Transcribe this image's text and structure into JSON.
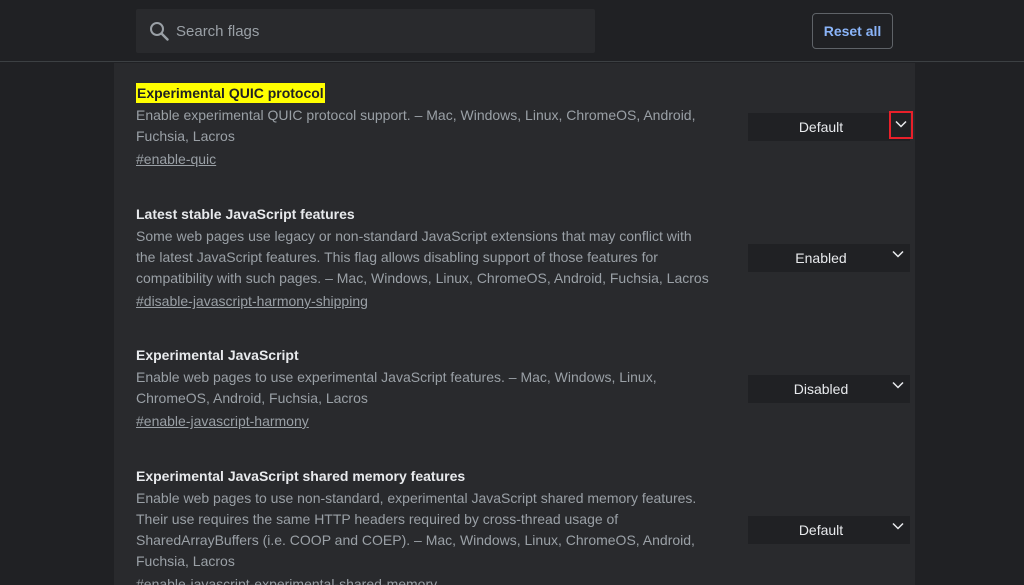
{
  "search": {
    "placeholder": "Search flags",
    "value": ""
  },
  "header": {
    "reset_label": "Reset all"
  },
  "flags": [
    {
      "title": "Experimental QUIC protocol",
      "description": "Enable experimental QUIC protocol support. – Mac, Windows, Linux, ChromeOS, Android, Fuchsia, Lacros",
      "link": "#enable-quic",
      "selected": "Default",
      "highlighted": true
    },
    {
      "title": "Latest stable JavaScript features",
      "description": "Some web pages use legacy or non-standard JavaScript extensions that may conflict with the latest JavaScript features. This flag allows disabling support of those features for compatibility with such pages. – Mac, Windows, Linux, ChromeOS, Android, Fuchsia, Lacros",
      "link": "#disable-javascript-harmony-shipping",
      "selected": "Enabled"
    },
    {
      "title": "Experimental JavaScript",
      "description": "Enable web pages to use experimental JavaScript features. – Mac, Windows, Linux, ChromeOS, Android, Fuchsia, Lacros",
      "link": "#enable-javascript-harmony",
      "selected": "Disabled"
    },
    {
      "title": "Experimental JavaScript shared memory features",
      "description": "Enable web pages to use non-standard, experimental JavaScript shared memory features. Their use requires the same HTTP headers required by cross-thread usage of SharedArrayBuffers (i.e. COOP and COEP). – Mac, Windows, Linux, ChromeOS, Android, Fuchsia, Lacros",
      "link": "#enable-javascript-experimental-shared-memory",
      "selected": "Default"
    }
  ],
  "colors": {
    "highlight": "#ffff00",
    "accent": "#8ab4f8",
    "focus_outline": "#e8202a"
  }
}
